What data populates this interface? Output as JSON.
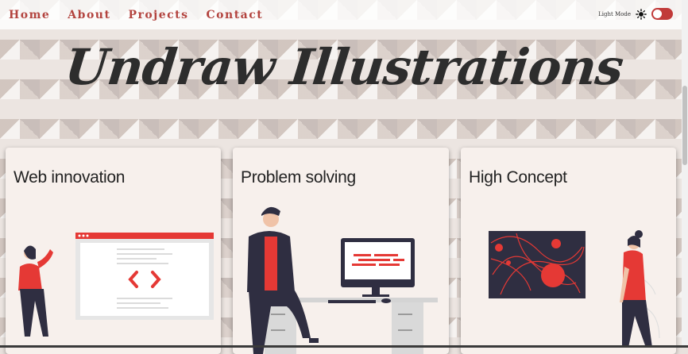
{
  "nav": {
    "links": [
      "Home",
      "About",
      "Projects",
      "Contact"
    ],
    "mode_label": "Light Mode",
    "toggle_on": true
  },
  "hero": {
    "title": "Undraw Illustrations"
  },
  "cards": [
    {
      "title": "Web innovation",
      "illustration": "web-developer"
    },
    {
      "title": "Problem solving",
      "illustration": "person-at-desk"
    },
    {
      "title": "High Concept",
      "illustration": "woman-with-abstract-board"
    }
  ],
  "colors": {
    "accent": "#b3443f",
    "illustration_red": "#e53935",
    "dark": "#2f2e41",
    "card_bg": "#f7f0ec"
  }
}
